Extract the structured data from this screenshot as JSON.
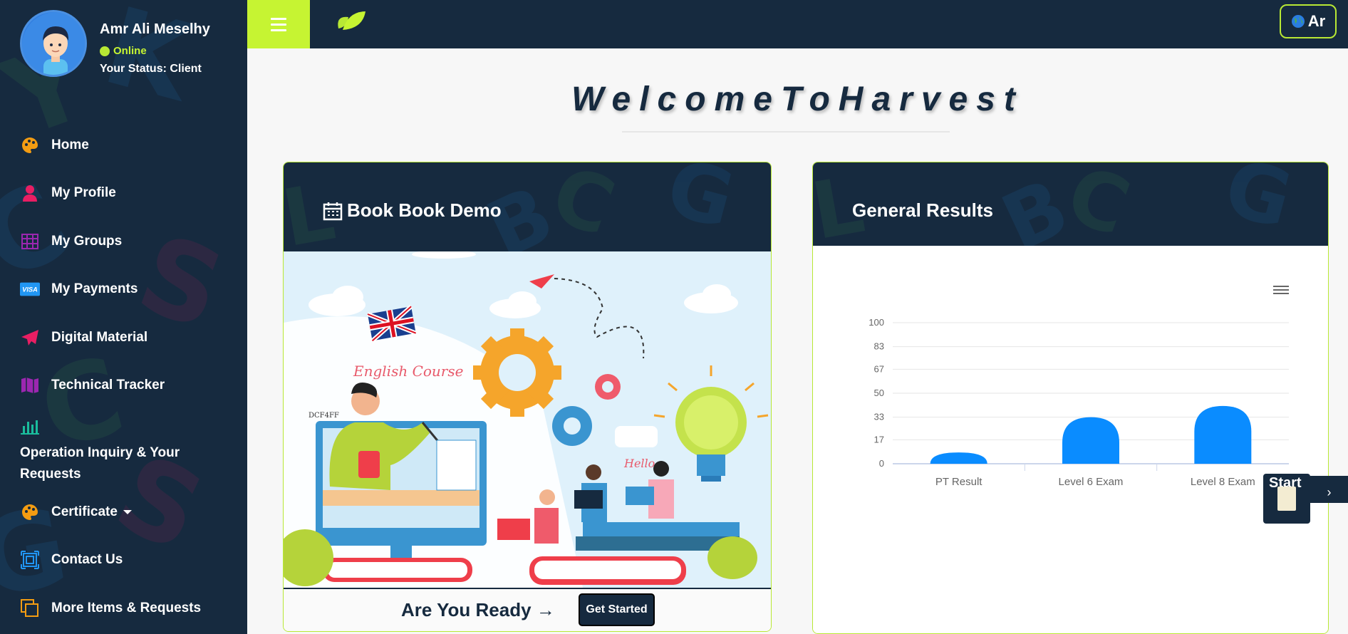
{
  "user": {
    "name": "Amr Ali Meselhy",
    "online_label": "Online",
    "status_text": "Your Status: Client"
  },
  "sidebar": {
    "items": [
      {
        "label": "Home",
        "icon": "palette-icon",
        "icon_color": "#f39c12"
      },
      {
        "label": "My Profile",
        "icon": "user-icon",
        "icon_color": "#e91e63"
      },
      {
        "label": "My Groups",
        "icon": "table-icon",
        "icon_color": "#9c27b0"
      },
      {
        "label": "My Payments",
        "icon": "visa-card-icon",
        "icon_color": "#2196f3"
      },
      {
        "label": "Digital Material",
        "icon": "paper-plane-icon",
        "icon_color": "#e91e63"
      },
      {
        "label": "Technical Tracker",
        "icon": "map-icon",
        "icon_color": "#9c27b0"
      },
      {
        "label": "Operation Inquiry & Your Requests",
        "icon": "bar-chart-icon",
        "icon_color": "#1abc9c"
      },
      {
        "label": "Certificate",
        "icon": "palette-icon",
        "icon_color": "#f39c12"
      },
      {
        "label": "Contact Us",
        "icon": "frame-icon",
        "icon_color": "#2196f3"
      },
      {
        "label": "More Items & Requests",
        "icon": "copy-icon",
        "icon_color": "#f39c12"
      }
    ]
  },
  "topbar": {
    "lang_label": "Ar"
  },
  "main": {
    "welcome": "WelcomeToHarvest",
    "demo_card": {
      "title": "Book Book Demo",
      "illustration_texts": [
        "English Course",
        "Hello",
        "DCF4FF"
      ],
      "ready_text": "Are You Ready →",
      "button_label": "Get Started"
    },
    "results_card": {
      "title": "General Results"
    }
  },
  "start_widget": {
    "label": "Start",
    "arrow": "›"
  },
  "colors": {
    "navy": "#162a3f",
    "lime": "#c6f432",
    "bar_blue": "#0a8cff"
  },
  "chart_data": {
    "type": "bar",
    "categories": [
      "PT Result",
      "Level 6 Exam",
      "Level 8 Exam"
    ],
    "values": [
      8,
      33,
      41
    ],
    "y_ticks": [
      0,
      17,
      33,
      50,
      67,
      83,
      100
    ],
    "ylim": [
      0,
      100
    ],
    "grid": true,
    "legend": "none"
  }
}
